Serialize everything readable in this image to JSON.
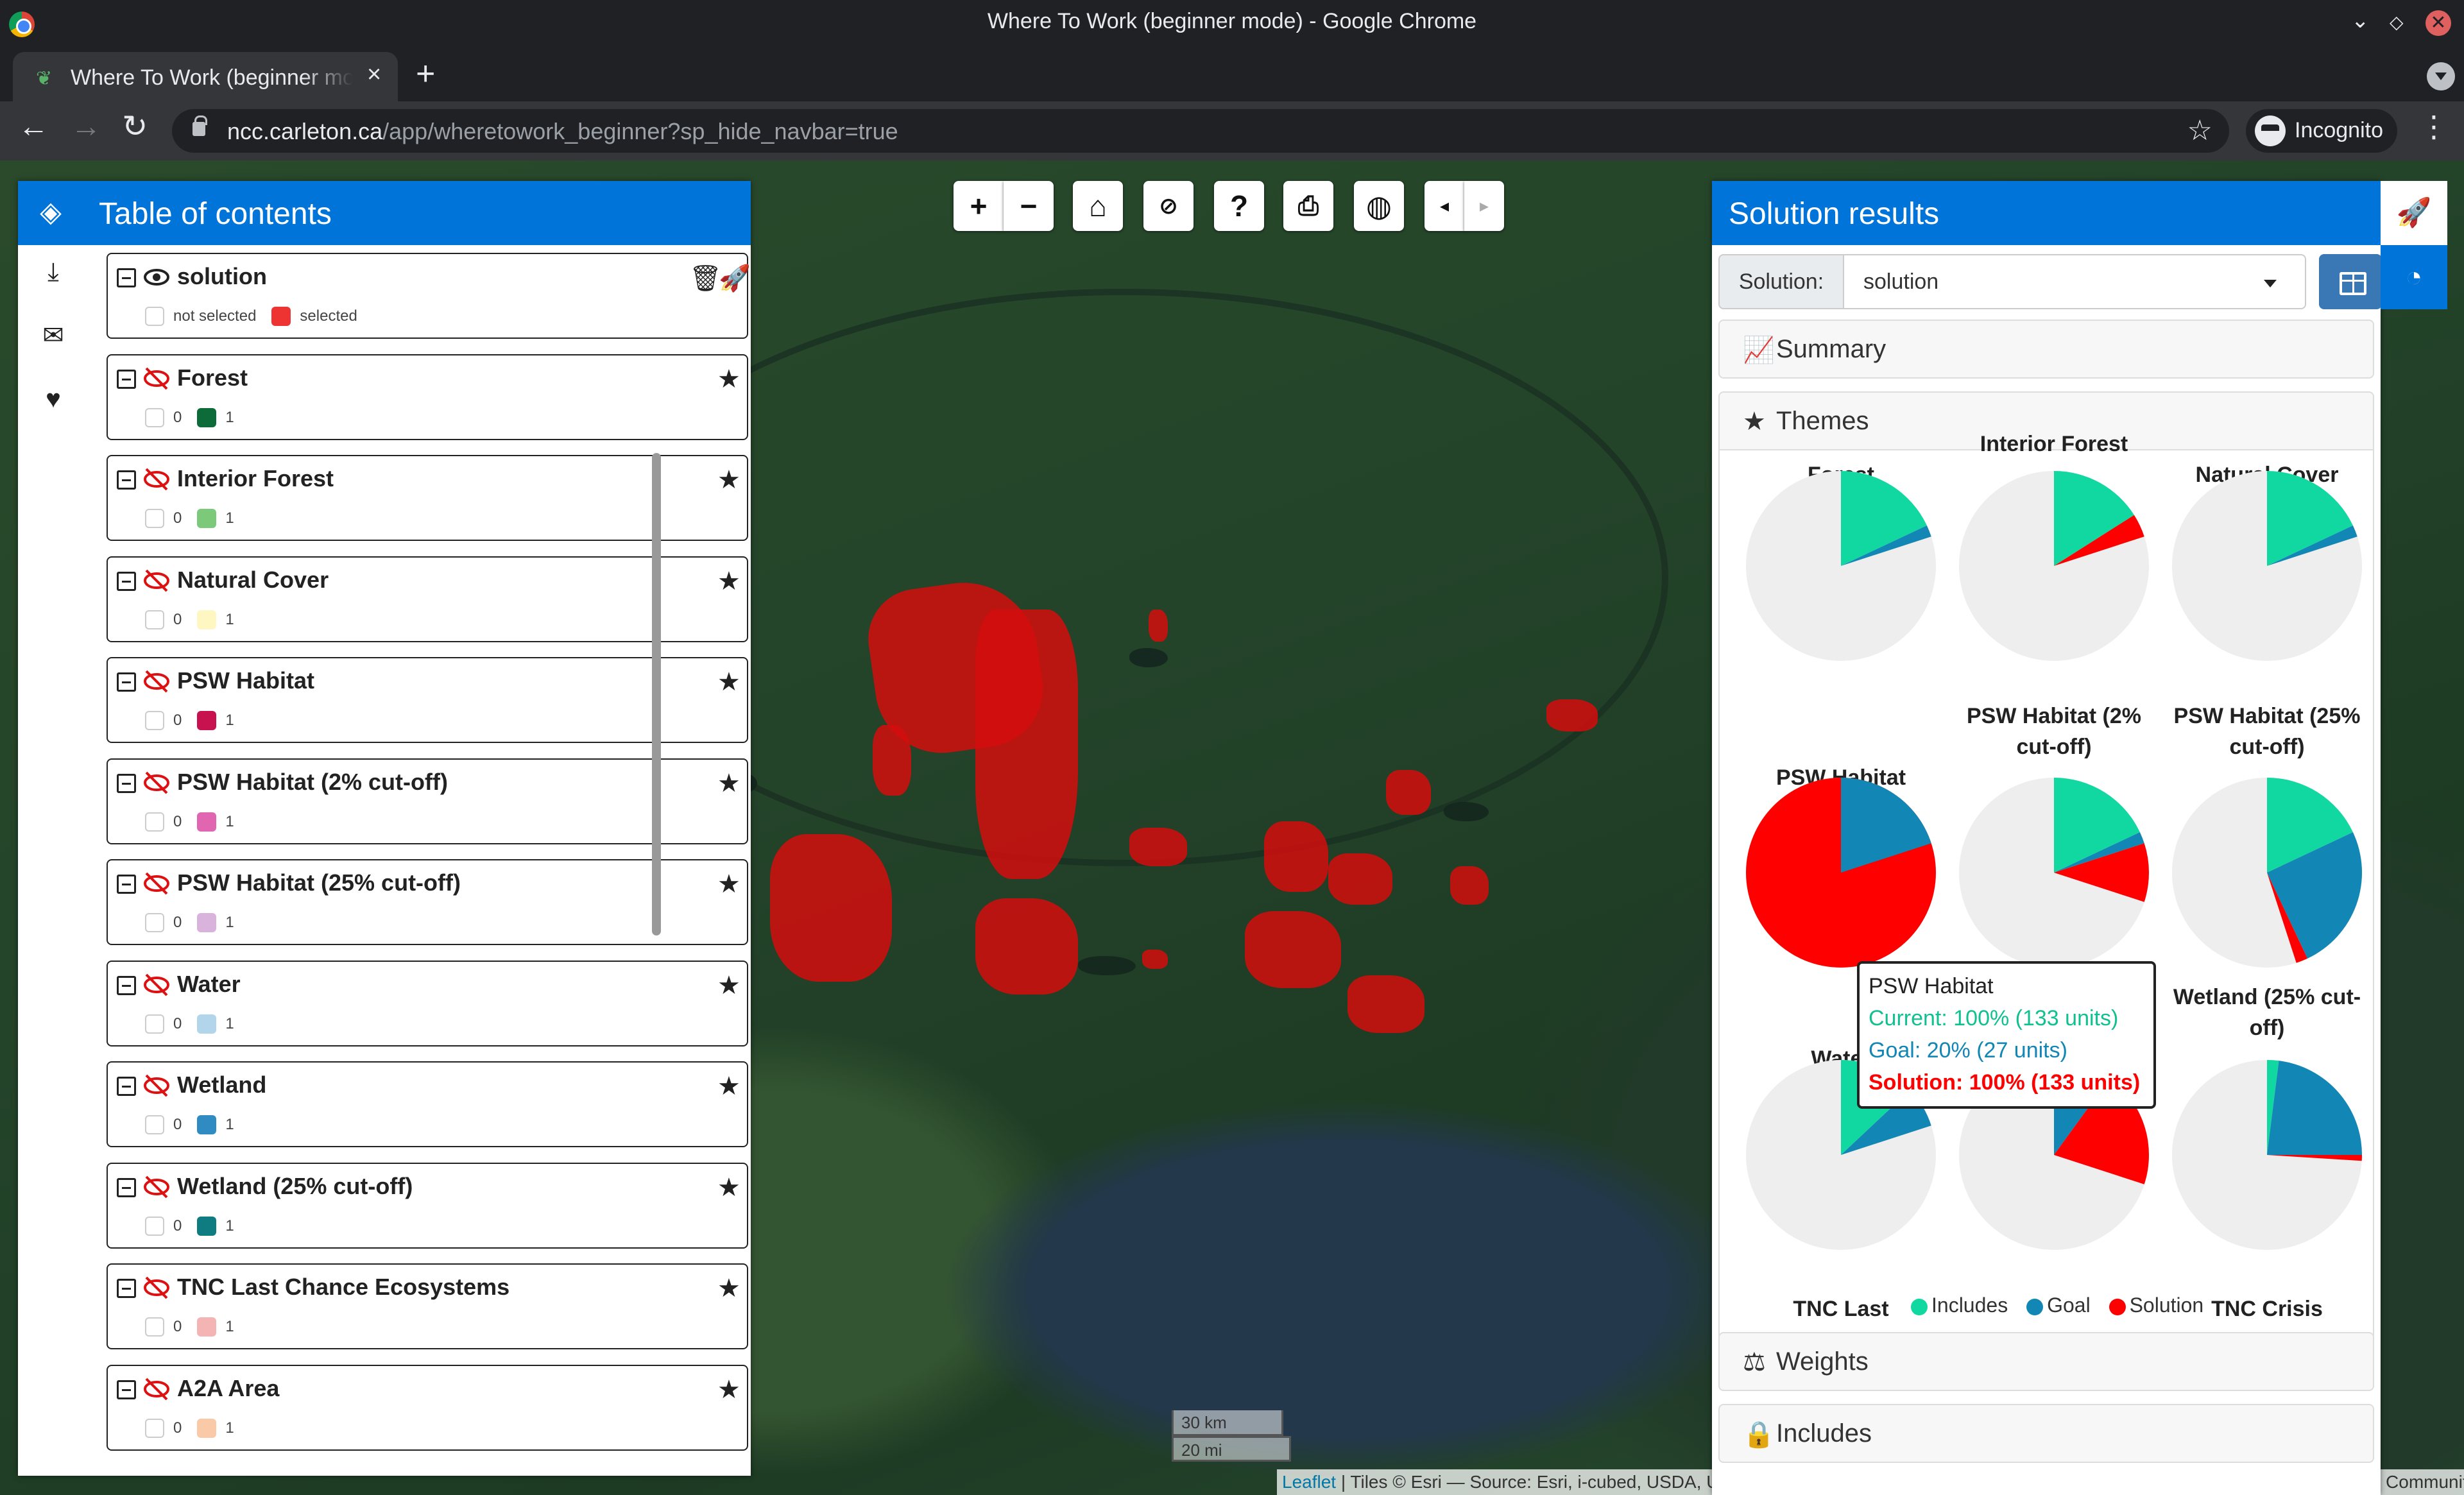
{
  "browser": {
    "window_title": "Where To Work (beginner mode) - Google Chrome",
    "tab_title": "Where To Work (beginner mode)",
    "url_host": "ncc.carleton.ca",
    "url_path": "/app/wheretowork_beginner?sp_hide_navbar=true",
    "profile": "Incognito"
  },
  "toc": {
    "title": "Table of contents",
    "layers": [
      {
        "name": "solution",
        "legend": [
          "not selected",
          "selected"
        ],
        "color": "#ee3333",
        "visible": true
      },
      {
        "name": "Forest",
        "legend": [
          "0",
          "1"
        ],
        "color": "#0d6b3a"
      },
      {
        "name": "Interior Forest",
        "legend": [
          "0",
          "1"
        ],
        "color": "#7cc97a"
      },
      {
        "name": "Natural Cover",
        "legend": [
          "0",
          "1"
        ],
        "color": "#fff7c2"
      },
      {
        "name": "PSW Habitat",
        "legend": [
          "0",
          "1"
        ],
        "color": "#c8124f"
      },
      {
        "name": "PSW Habitat (2% cut-off)",
        "legend": [
          "0",
          "1"
        ],
        "color": "#e066b2"
      },
      {
        "name": "PSW Habitat (25% cut-off)",
        "legend": [
          "0",
          "1"
        ],
        "color": "#d9b3dc"
      },
      {
        "name": "Water",
        "legend": [
          "0",
          "1"
        ],
        "color": "#b3d5ec"
      },
      {
        "name": "Wetland",
        "legend": [
          "0",
          "1"
        ],
        "color": "#2f8bc2"
      },
      {
        "name": "Wetland (25% cut-off)",
        "legend": [
          "0",
          "1"
        ],
        "color": "#0f7c82"
      },
      {
        "name": "TNC Last Chance Ecosystems",
        "legend": [
          "0",
          "1"
        ],
        "color": "#f5b4b4"
      },
      {
        "name": "A2A Area",
        "legend": [
          "0",
          "1"
        ],
        "color": "#f9c9a8"
      }
    ]
  },
  "map": {
    "scale_km": "30 km",
    "scale_mi": "20 mi",
    "attribution_link": "Leaflet",
    "attribution_text": " | Tiles © Esri — Source: Esri, i-cubed, USDA, USGS, AEX, GeoEye, Getmapping, Aerogrid, IGN, IGP, UPR-EGP, and the GIS User Community"
  },
  "solution_panel": {
    "title": "Solution results",
    "solution_label": "Solution:",
    "solution_value": "solution",
    "sections": {
      "summary": "Summary",
      "themes": "Themes",
      "weights": "Weights",
      "includes": "Includes"
    },
    "legend": {
      "includes": "Includes",
      "goal": "Goal",
      "solution": "Solution"
    },
    "tooltip": {
      "title": "PSW Habitat",
      "current": "Current: 100% (133 units)",
      "goal": "Goal: 20% (27 units)",
      "solution": "Solution: 100% (133 units)"
    },
    "colors": {
      "includes": "#11d8a1",
      "goal": "#1286b5",
      "solution": "#ff0000",
      "bg": "#eeeeee"
    }
  },
  "chart_data": {
    "type": "pie",
    "note": "Themes pie charts; each shows Includes / Goal / Solution coverage",
    "series": [
      {
        "name": "Forest",
        "includes": 0.18,
        "goal": 0.02,
        "solution": 0.0
      },
      {
        "name": "Interior Forest",
        "includes": 0.16,
        "goal": 0.0,
        "solution": 0.04
      },
      {
        "name": "Natural Cover",
        "includes": 0.18,
        "goal": 0.02,
        "solution": 0.0
      },
      {
        "name": "PSW Habitat",
        "includes": 0.0,
        "goal": 0.2,
        "solution": 1.0
      },
      {
        "name": "PSW Habitat (2% cut-off)",
        "includes": 0.18,
        "goal": 0.02,
        "solution": 0.1
      },
      {
        "name": "PSW Habitat (25% cut-off)",
        "includes": 0.18,
        "goal": 0.25,
        "solution": 0.02
      },
      {
        "name": "Water",
        "includes": 0.13,
        "goal": 0.07,
        "solution": 0.0
      },
      {
        "name": "",
        "includes": 0.0,
        "goal": 0.1,
        "solution": 0.2
      },
      {
        "name": "Wetland (25% cut-off)",
        "includes": 0.02,
        "goal": 0.23,
        "solution": 0.01
      },
      {
        "name": "TNC Last"
      },
      {
        "name": ""
      },
      {
        "name": "TNC Crisis"
      }
    ]
  }
}
